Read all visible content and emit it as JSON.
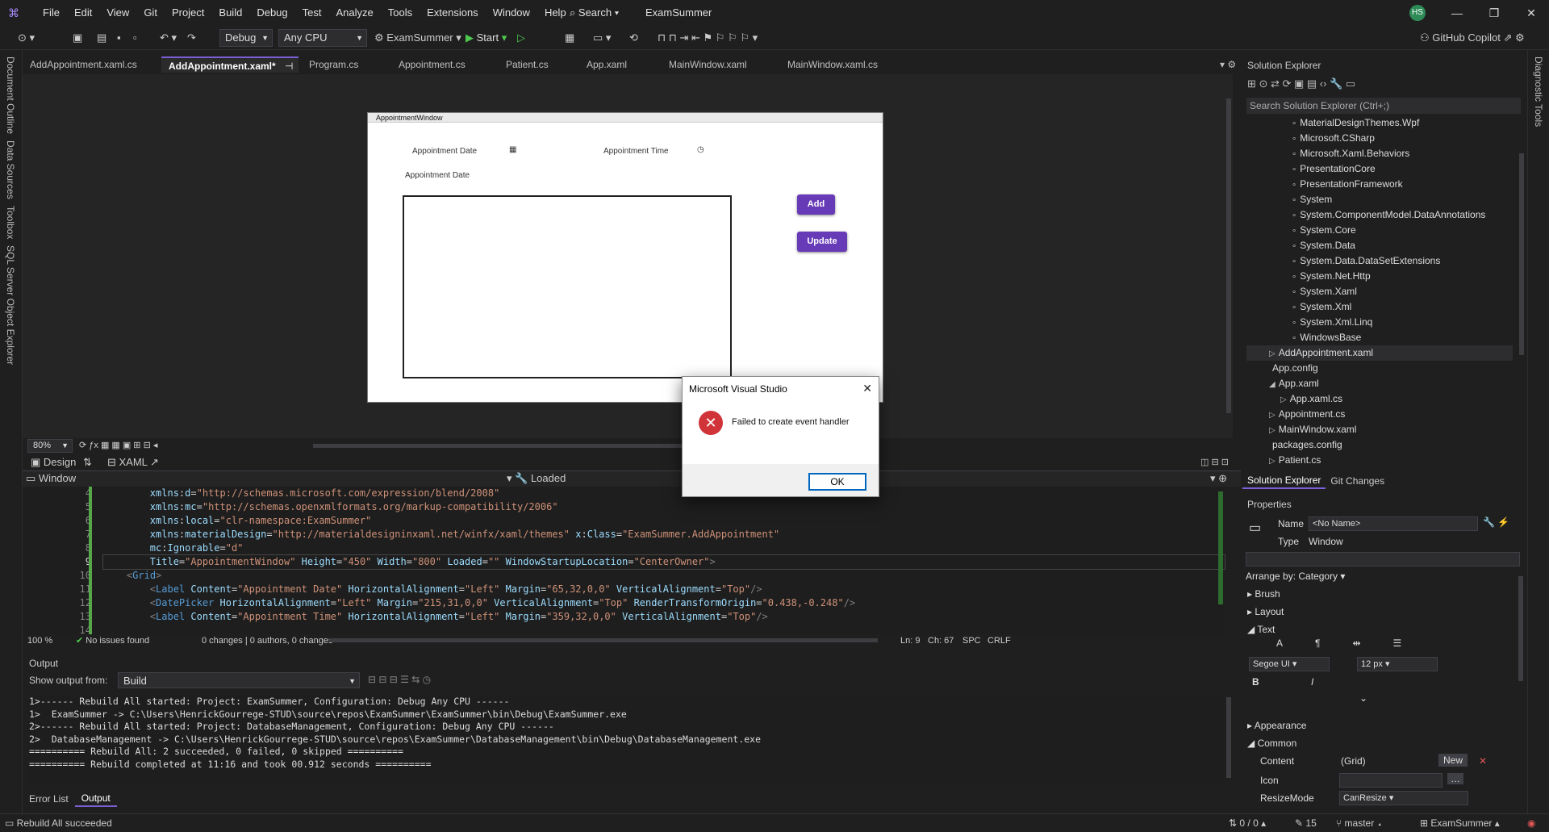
{
  "menubar": {
    "items": [
      "File",
      "Edit",
      "View",
      "Git",
      "Project",
      "Build",
      "Debug",
      "Test",
      "Analyze",
      "Tools",
      "Extensions",
      "Window",
      "Help"
    ],
    "search_label": "Search",
    "solution_name": "ExamSummer",
    "avatar_initials": "HS"
  },
  "toolbar": {
    "config": "Debug",
    "platform": "Any CPU",
    "startup_project": "ExamSummer",
    "start_label": "Start",
    "copilot_label": "GitHub Copilot"
  },
  "left_rail": [
    "Document Outline",
    "Data Sources",
    "Toolbox",
    "SQL Server Object Explorer"
  ],
  "right_rail": [
    "Diagnostic Tools"
  ],
  "doc_tabs": [
    {
      "label": "AddAppointment.xaml.cs",
      "active": false
    },
    {
      "label": "AddAppointment.xaml*",
      "active": true
    },
    {
      "label": "Program.cs",
      "active": false
    },
    {
      "label": "Appointment.cs",
      "active": false
    },
    {
      "label": "Patient.cs",
      "active": false
    },
    {
      "label": "App.xaml",
      "active": false
    },
    {
      "label": "MainWindow.xaml",
      "active": false
    },
    {
      "label": "MainWindow.xaml.cs",
      "active": false
    }
  ],
  "wpf_window": {
    "title": "AppointmentWindow",
    "label_date1": "Appointment Date",
    "label_time": "Appointment Time",
    "label_date2": "Appointment Date",
    "btn_add": "Add",
    "btn_update": "Update"
  },
  "designer_strip": {
    "zoom": "80%",
    "design_tab": "Design",
    "xaml_tab": "XAML"
  },
  "nav_bar": {
    "scope": "Window",
    "event": "Loaded"
  },
  "editor": {
    "line_numbers": [
      "4",
      "5",
      "6",
      "7",
      "8",
      "9",
      "10",
      "11",
      "12",
      "13",
      "14"
    ],
    "current_line_index": 5
  },
  "editor_status": {
    "zoom": "100 %",
    "issues": "No issues found",
    "changes": "0 changes | 0 authors, 0 changes",
    "ln": "Ln: 9",
    "ch": "Ch: 67",
    "spc": "SPC",
    "crlf": "CRLF"
  },
  "output": {
    "title": "Output",
    "show_from_label": "Show output from:",
    "source": "Build",
    "lines": [
      "1>------ Rebuild All started: Project: ExamSummer, Configuration: Debug Any CPU ------",
      "1>  ExamSummer -> C:\\Users\\HenrickGourrege-STUD\\source\\repos\\ExamSummer\\ExamSummer\\bin\\Debug\\ExamSummer.exe",
      "2>------ Rebuild All started: Project: DatabaseManagement, Configuration: Debug Any CPU ------",
      "2>  DatabaseManagement -> C:\\Users\\HenrickGourrege-STUD\\source\\repos\\ExamSummer\\DatabaseManagement\\bin\\Debug\\DatabaseManagement.exe",
      "========== Rebuild All: 2 succeeded, 0 failed, 0 skipped ==========",
      "========== Rebuild completed at 11:16 and took 00.912 seconds =========="
    ],
    "tabs": [
      "Error List",
      "Output"
    ]
  },
  "solution_explorer": {
    "title": "Solution Explorer",
    "search_placeholder": "Search Solution Explorer (Ctrl+;)",
    "items": [
      {
        "label": "MaterialDesignThemes.Wpf",
        "indent": 4,
        "icon": "∘"
      },
      {
        "label": "Microsoft.CSharp",
        "indent": 4,
        "icon": "∘"
      },
      {
        "label": "Microsoft.Xaml.Behaviors",
        "indent": 4,
        "icon": "∘"
      },
      {
        "label": "PresentationCore",
        "indent": 4,
        "icon": "∘"
      },
      {
        "label": "PresentationFramework",
        "indent": 4,
        "icon": "∘"
      },
      {
        "label": "System",
        "indent": 4,
        "icon": "∘"
      },
      {
        "label": "System.ComponentModel.DataAnnotations",
        "indent": 4,
        "icon": "∘"
      },
      {
        "label": "System.Core",
        "indent": 4,
        "icon": "∘"
      },
      {
        "label": "System.Data",
        "indent": 4,
        "icon": "∘"
      },
      {
        "label": "System.Data.DataSetExtensions",
        "indent": 4,
        "icon": "∘"
      },
      {
        "label": "System.Net.Http",
        "indent": 4,
        "icon": "∘"
      },
      {
        "label": "System.Xaml",
        "indent": 4,
        "icon": "∘"
      },
      {
        "label": "System.Xml",
        "indent": 4,
        "icon": "∘"
      },
      {
        "label": "System.Xml.Linq",
        "indent": 4,
        "icon": "∘"
      },
      {
        "label": "WindowsBase",
        "indent": 4,
        "icon": "∘"
      },
      {
        "label": "AddAppointment.xaml",
        "indent": 2,
        "icon": "▷",
        "selected": true
      },
      {
        "label": "App.config",
        "indent": 2,
        "icon": " "
      },
      {
        "label": "App.xaml",
        "indent": 2,
        "icon": "◢"
      },
      {
        "label": "App.xaml.cs",
        "indent": 3,
        "icon": "▷"
      },
      {
        "label": "Appointment.cs",
        "indent": 2,
        "icon": "▷"
      },
      {
        "label": "MainWindow.xaml",
        "indent": 2,
        "icon": "▷"
      },
      {
        "label": "packages.config",
        "indent": 2,
        "icon": " "
      },
      {
        "label": "Patient.cs",
        "indent": 2,
        "icon": "▷"
      }
    ],
    "bottom_tabs": [
      "Solution Explorer",
      "Git Changes"
    ]
  },
  "properties": {
    "title": "Properties",
    "name_label": "Name",
    "name_value": "<No Name>",
    "type_label": "Type",
    "type_value": "Window",
    "arrange_by": "Arrange by: Category",
    "sections": [
      "Brush",
      "Layout",
      "Text"
    ],
    "font": "Segoe UI",
    "font_size": "12 px",
    "appearance": "Appearance",
    "common": "Common",
    "content_label": "Content",
    "content_value": "(Grid)",
    "new_label": "New",
    "icon_label": "Icon",
    "resize_label": "ResizeMode",
    "resize_value": "CanResize"
  },
  "dialog": {
    "title": "Microsoft Visual Studio",
    "message": "Failed to create event handler",
    "ok": "OK"
  },
  "statusbar": {
    "message": "Rebuild All succeeded",
    "updown": "0 / 0",
    "edits": "15",
    "branch": "master",
    "repo": "ExamSummer"
  }
}
